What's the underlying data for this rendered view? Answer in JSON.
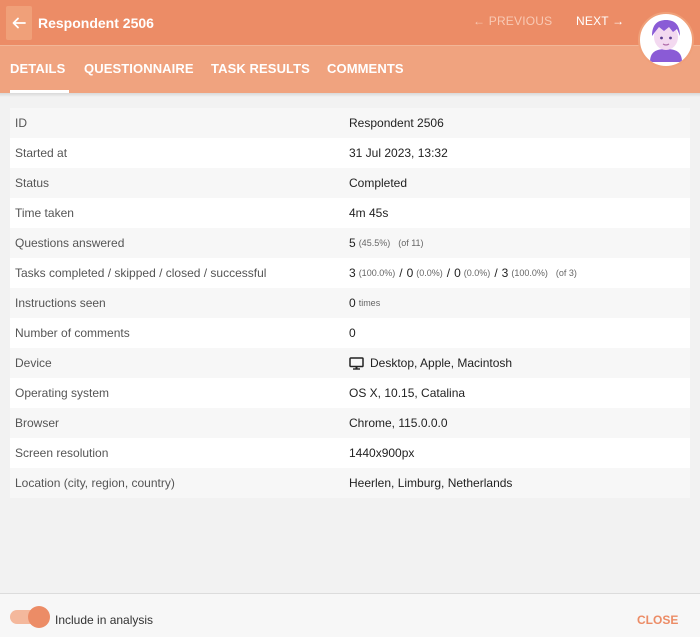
{
  "header": {
    "title": "Respondent 2506",
    "back_icon": "arrow-left-icon",
    "previous_label": "← PREVIOUS",
    "next_label": "NEXT →",
    "accent_color": "#ec8c66"
  },
  "tabs": [
    {
      "label": "DETAILS",
      "active": true
    },
    {
      "label": "QUESTIONNAIRE",
      "active": false
    },
    {
      "label": "TASK RESULTS",
      "active": false
    },
    {
      "label": "COMMENTS",
      "active": false
    }
  ],
  "details": {
    "id": {
      "label": "ID",
      "value": "Respondent 2506"
    },
    "started": {
      "label": "Started at",
      "value": "31 Jul 2023, 13:32"
    },
    "status": {
      "label": "Status",
      "value": "Completed"
    },
    "time_taken": {
      "label": "Time taken",
      "value": "4m 45s"
    },
    "questions": {
      "label": "Questions answered",
      "count": "5",
      "percent": "(45.5%)",
      "of": "(of 11)"
    },
    "tasks": {
      "label": "Tasks completed / skipped / closed / successful",
      "completed": "3",
      "completed_pct": "(100.0%)",
      "skipped": "0",
      "skipped_pct": "(0.0%)",
      "closed": "0",
      "closed_pct": "(0.0%)",
      "successful": "3",
      "successful_pct": "(100.0%)",
      "of": "(of 3)",
      "separator": "/"
    },
    "instructions": {
      "label": "Instructions seen",
      "count": "0",
      "unit": "times"
    },
    "comments": {
      "label": "Number of comments",
      "value": "0"
    },
    "device": {
      "label": "Device",
      "value": "Desktop, Apple, Macintosh",
      "icon": "monitor-icon"
    },
    "os": {
      "label": "Operating system",
      "value": "OS X, 10.15, Catalina"
    },
    "browser": {
      "label": "Browser",
      "value": "Chrome, 115.0.0.0"
    },
    "resolution": {
      "label": "Screen resolution",
      "value": "1440x900px"
    },
    "location": {
      "label": "Location (city, region, country)",
      "value": "Heerlen, Limburg, Netherlands"
    }
  },
  "footer": {
    "include_label": "Include in analysis",
    "include_on": true,
    "close_label": "CLOSE"
  }
}
